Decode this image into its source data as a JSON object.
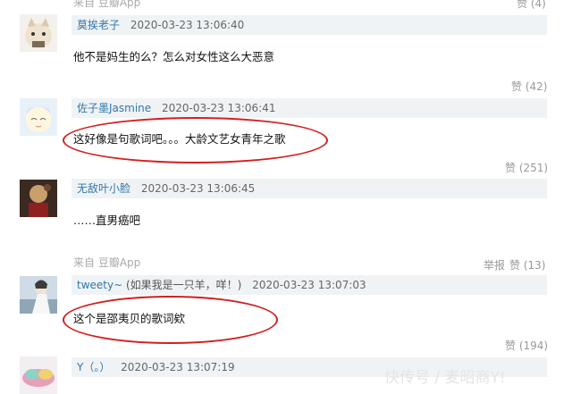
{
  "top_partial": {
    "from_label": "来自 豆瓣App",
    "votes": "赞 (4)"
  },
  "comments": [
    {
      "username": "莫挨老子",
      "time": "2020-03-23 13:06:40",
      "text": "他不是妈生的么？怎么对女性这么大恶意",
      "votes": "赞 (42)"
    },
    {
      "username": "佐子墨Jasmine",
      "time": "2020-03-23 13:06:41",
      "text": "这好像是句歌词吧。。。大龄文艺女青年之歌",
      "votes": "赞 (251)"
    },
    {
      "username": "无敌叶小脸",
      "time": "2020-03-23 13:06:45",
      "text": "……直男癌吧",
      "from_label": "来自 豆瓣App",
      "report_label": "举报",
      "votes": "赞 (13)"
    },
    {
      "username": "tweety~",
      "username_note": "(如果我是一只羊，咩！)",
      "time": "2020-03-23 13:07:03",
      "text": "这个是邵夷贝的歌词欸",
      "votes": "赞 (194)"
    },
    {
      "username": "Y（。）",
      "time": "2020-03-23 13:07:19"
    }
  ],
  "watermark": "快传号 / 麦昭商Y! ",
  "colors": {
    "annotation": "#d41f1f",
    "username": "#3377aa",
    "header_bg": "#f0f3f5"
  }
}
